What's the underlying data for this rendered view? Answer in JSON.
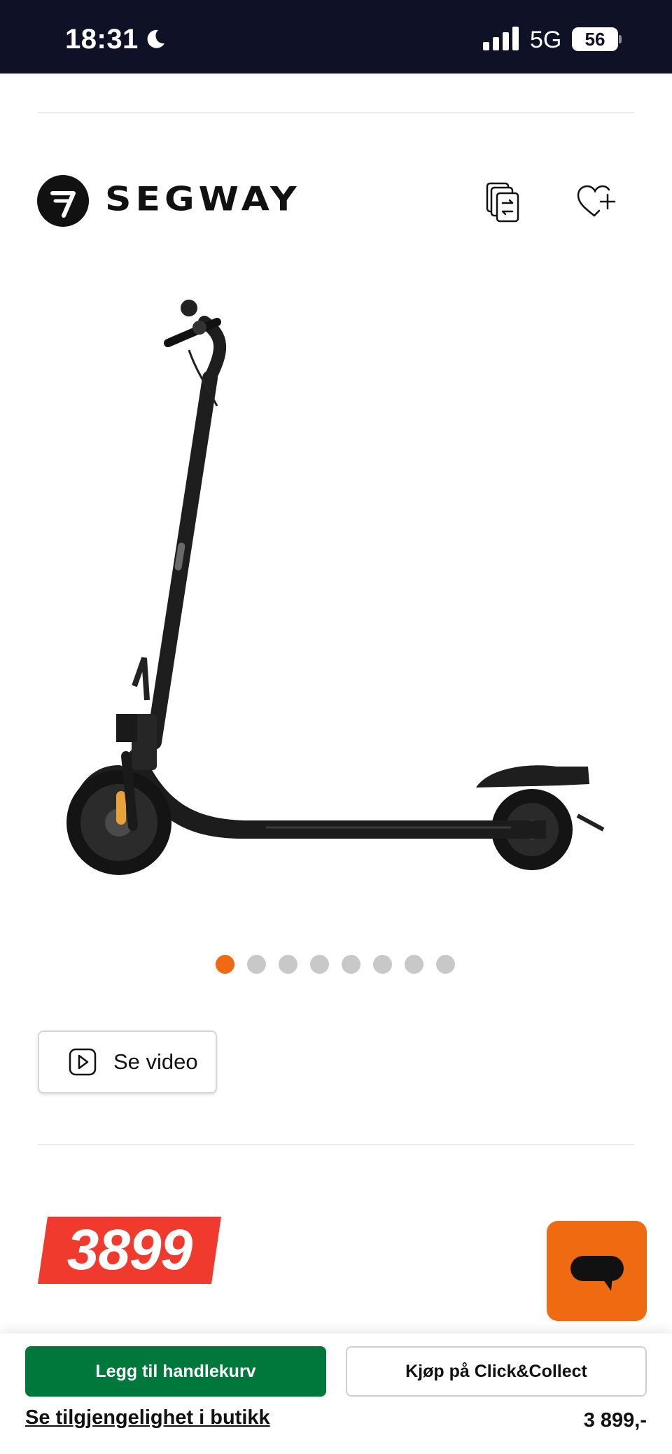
{
  "status_bar": {
    "time": "18:31",
    "network": "5G",
    "battery": "56"
  },
  "brand": {
    "name": "SEGWAY"
  },
  "icons": {
    "compare": "compare-icon",
    "wishlist": "heart-plus-icon",
    "video": "play-icon",
    "chat": "chat-icon",
    "moon": "moon-icon",
    "signal": "signal-icon"
  },
  "carousel": {
    "total": 8,
    "active_index": 0
  },
  "video_button": {
    "label": "Se video"
  },
  "price": {
    "badge": "3899",
    "formatted": "3 899,-"
  },
  "actions": {
    "add_to_cart": "Legg til handlekurv",
    "click_collect": "Kjøp på Click&Collect",
    "availability_link": "Se tilgjengelighet i butikk"
  },
  "colors": {
    "accent_orange": "#f06a12",
    "cart_green": "#00783c",
    "price_red": "#f03a2e",
    "status_bar": "#0f1226"
  }
}
